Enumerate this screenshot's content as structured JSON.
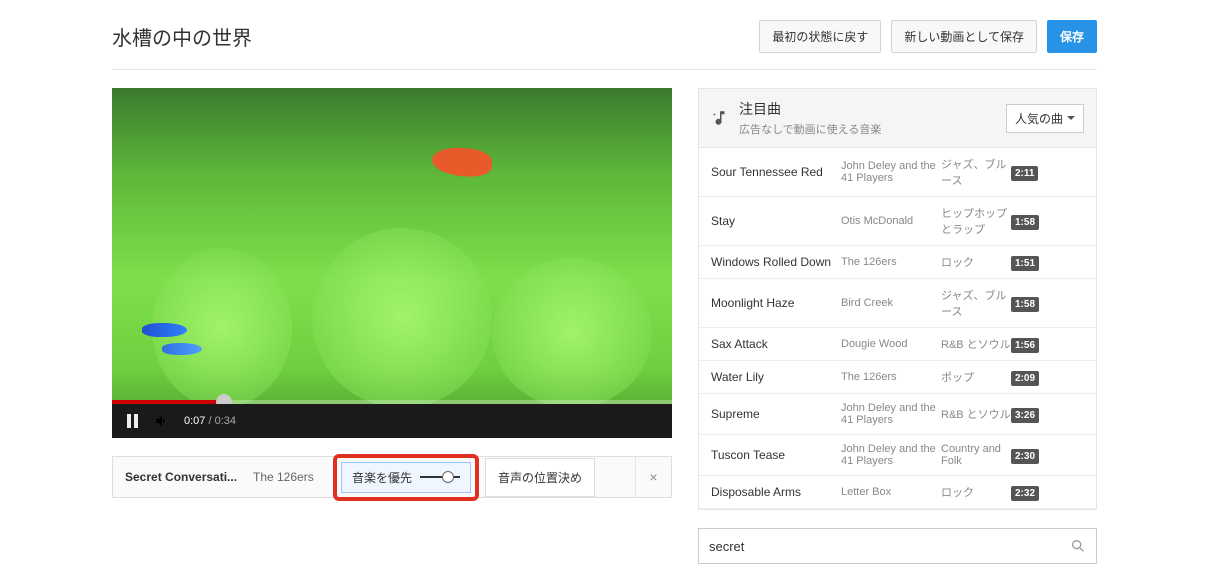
{
  "header": {
    "title": "水槽の中の世界",
    "revert_label": "最初の状態に戻す",
    "save_as_label": "新しい動画として保存",
    "save_label": "保存"
  },
  "player": {
    "current_time": "0:07",
    "duration": "0:34"
  },
  "audio_strip": {
    "track_title": "Secret Conversati...",
    "track_artist": "The 126ers",
    "mix_label": "音楽を優先",
    "position_label": "音声の位置決め"
  },
  "music_panel": {
    "title": "注目曲",
    "subtitle": "広告なしで動画に使える音楽",
    "sort_label": "人気の曲",
    "tracks": [
      {
        "title": "Sour Tennessee Red",
        "artist": "John Deley and the 41 Players",
        "genre": "ジャズ、ブルース",
        "duration": "2:11"
      },
      {
        "title": "Stay",
        "artist": "Otis McDonald",
        "genre": "ヒップホップとラップ",
        "duration": "1:58"
      },
      {
        "title": "Windows Rolled Down",
        "artist": "The 126ers",
        "genre": "ロック",
        "duration": "1:51"
      },
      {
        "title": "Moonlight Haze",
        "artist": "Bird Creek",
        "genre": "ジャズ、ブルース",
        "duration": "1:58"
      },
      {
        "title": "Sax Attack",
        "artist": "Dougie Wood",
        "genre": "R&B とソウル",
        "duration": "1:56"
      },
      {
        "title": "Water Lily",
        "artist": "The 126ers",
        "genre": "ポップ",
        "duration": "2:09"
      },
      {
        "title": "Supreme",
        "artist": "John Deley and the 41 Players",
        "genre": "R&B とソウル",
        "duration": "3:26"
      },
      {
        "title": "Tuscon Tease",
        "artist": "John Deley and the 41 Players",
        "genre": "Country and Folk",
        "duration": "2:30"
      },
      {
        "title": "Disposable Arms",
        "artist": "Letter Box",
        "genre": "ロック",
        "duration": "2:32"
      }
    ]
  },
  "search": {
    "value": "secret"
  }
}
